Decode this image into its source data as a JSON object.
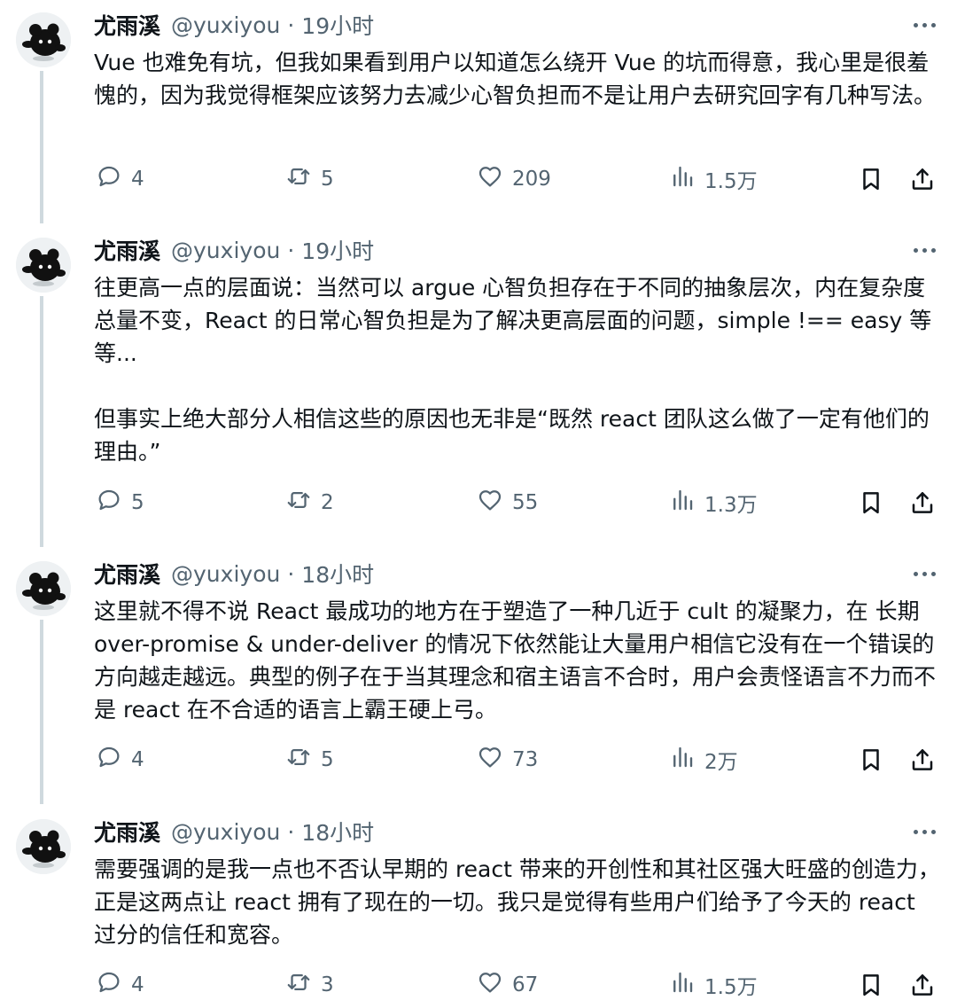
{
  "tweets": [
    {
      "name": "尤雨溪",
      "handle": "@yuxiyou",
      "dot": "·",
      "time": "19小时",
      "paragraphs": [
        "Vue 也难免有坑，但我如果看到用户以知道怎么绕开 Vue 的坑而得意，我心里是很羞愧的，因为我觉得框架应该努力去减少心智负担而不是让用户去研究回字有几种写法。"
      ],
      "replies": "4",
      "retweets": "5",
      "likes": "209",
      "views": "1.5万"
    },
    {
      "name": "尤雨溪",
      "handle": "@yuxiyou",
      "dot": "·",
      "time": "19小时",
      "paragraphs": [
        "往更高一点的层面说：当然可以 argue 心智负担存在于不同的抽象层次，内在复杂度总量不变，React 的日常心智负担是为了解决更高层面的问题，simple !== easy 等等...",
        "但事实上绝大部分人相信这些的原因也无非是“既然 react 团队这么做了一定有他们的理由。”"
      ],
      "replies": "5",
      "retweets": "2",
      "likes": "55",
      "views": "1.3万"
    },
    {
      "name": "尤雨溪",
      "handle": "@yuxiyou",
      "dot": "·",
      "time": "18小时",
      "paragraphs": [
        "这里就不得不说 React 最成功的地方在于塑造了一种几近于 cult 的凝聚力，在 长期 over-promise & under-deliver 的情况下依然能让大量用户相信它没有在一个错误的方向越走越远。典型的例子在于当其理念和宿主语言不合时，用户会责怪语言不力而不是 react 在不合适的语言上霸王硬上弓。"
      ],
      "replies": "4",
      "retweets": "5",
      "likes": "73",
      "views": "2万"
    },
    {
      "name": "尤雨溪",
      "handle": "@yuxiyou",
      "dot": "·",
      "time": "18小时",
      "paragraphs": [
        "需要强调的是我一点也不否认早期的 react 带来的开创性和其社区强大旺盛的创造力，正是这两点让 react 拥有了现在的一切。我只是觉得有些用户们给予了今天的 react 过分的信任和宽容。"
      ],
      "replies": "4",
      "retweets": "3",
      "likes": "67",
      "views": "1.5万"
    }
  ],
  "icons": {
    "reply": "speech-bubble-icon",
    "retweet": "retweet-arrows-icon",
    "like": "heart-icon",
    "views": "bar-chart-icon",
    "bookmark": "bookmark-icon",
    "share": "share-upload-icon",
    "more": "more-dots-icon"
  },
  "colors": {
    "text": "#0f1419",
    "secondary": "#536471",
    "thread_line": "#cfd9de"
  }
}
